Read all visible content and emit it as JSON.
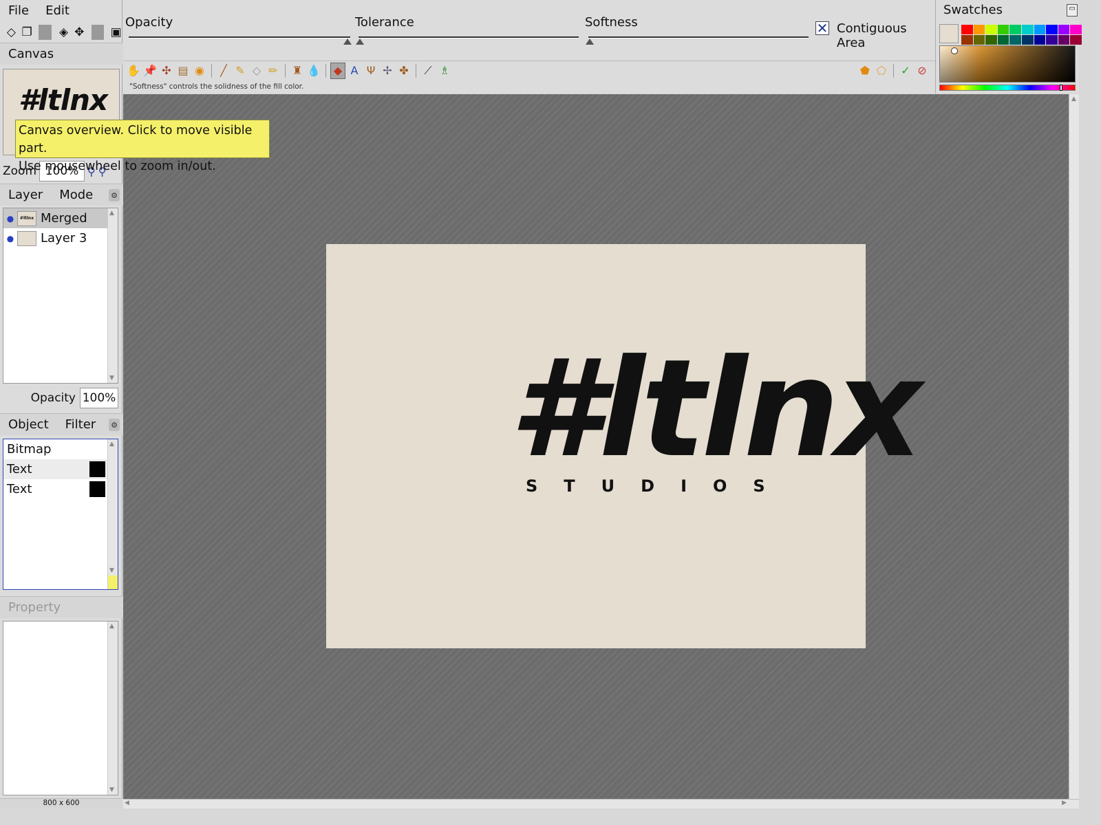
{
  "menu": {
    "file": "File",
    "edit": "Edit"
  },
  "canvas_panel": {
    "title": "Canvas",
    "overview_logo": "#ltlnx",
    "tooltip_line1": "Canvas overview. Click to move visible part.",
    "tooltip_line2": "Use mousewheel to zoom in/out.",
    "zoom_label": "Zoom",
    "zoom_value": "100%"
  },
  "layer_panel": {
    "tabs": [
      "Layer",
      "Mode"
    ],
    "layers": [
      {
        "name": "Merged",
        "visible": true,
        "selected": true
      },
      {
        "name": "Layer 3",
        "visible": true,
        "selected": false
      }
    ],
    "opacity_label": "Opacity",
    "opacity_value": "100%"
  },
  "object_panel": {
    "tabs": [
      "Object",
      "Filter"
    ],
    "objects": [
      {
        "name": "Bitmap",
        "swatch": null
      },
      {
        "name": "Text",
        "swatch": "#000000"
      },
      {
        "name": "Text",
        "swatch": "#000000"
      }
    ]
  },
  "property_panel": {
    "title": "Property"
  },
  "status": {
    "doc_size": "800 x 600"
  },
  "tool_options": {
    "opacity_label": "Opacity",
    "tolerance_label": "Tolerance",
    "softness_label": "Softness",
    "contiguous_label": "Contiguous Area",
    "contiguous_checked": true,
    "hint": "\"Softness\" controls the solidness of the fill color."
  },
  "swatches": {
    "title": "Swatches",
    "current_color": "#e4ddd0",
    "row1": [
      "#ff0000",
      "#ff9900",
      "#ccff00",
      "#33cc00",
      "#00cc66",
      "#00cccc",
      "#0099ff",
      "#0000ff",
      "#9900ff",
      "#ff00cc"
    ],
    "row2": [
      "#993300",
      "#666600",
      "#336600",
      "#006633",
      "#006666",
      "#003366",
      "#000099",
      "#330099",
      "#660066",
      "#990033"
    ]
  },
  "document": {
    "wordmark": "#ltlnx",
    "subtitle": "STUDIOS",
    "background": "#e4ddd0"
  }
}
